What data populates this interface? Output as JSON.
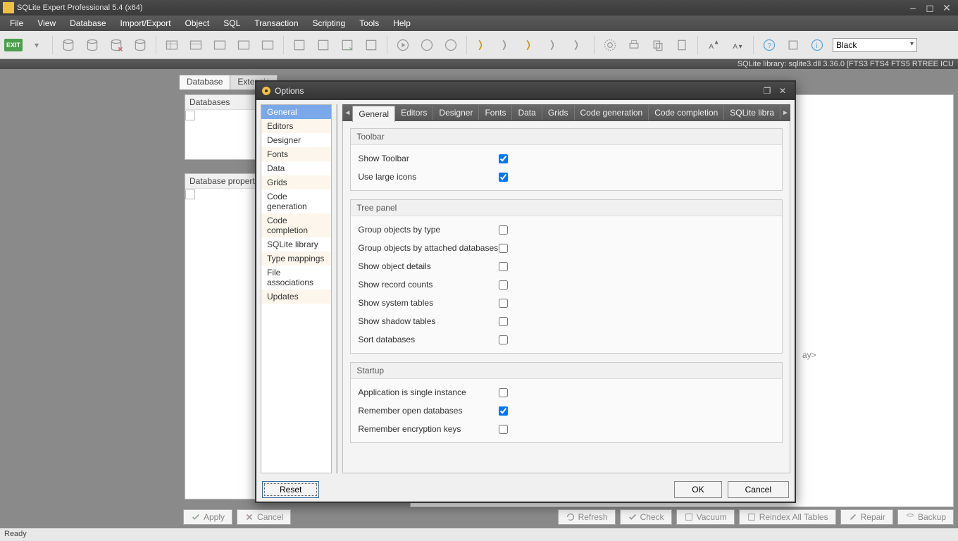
{
  "title": "SQLite Expert Professional 5.4 (x64)",
  "menu": [
    "File",
    "View",
    "Database",
    "Import/Export",
    "Object",
    "SQL",
    "Transaction",
    "Scripting",
    "Tools",
    "Help"
  ],
  "toolbar": {
    "exit": "EXIT",
    "theme_combo": "Black"
  },
  "libstrip": "SQLite library: sqlite3.dll 3.36.0 [FTS3 FTS4 FTS5 RTREE ICU",
  "left_tabs": [
    "Database",
    "Extensio"
  ],
  "panel_databases": "Databases",
  "panel_dbprops": "Database propert",
  "right_placeholder": "ay>",
  "bottom_buttons": {
    "apply": "Apply",
    "cancel": "Cancel",
    "refresh": "Refresh",
    "check": "Check",
    "vacuum": "Vacuum",
    "reindex": "Reindex All Tables",
    "repair": "Repair",
    "backup": "Backup"
  },
  "status": "Ready",
  "dialog": {
    "title": "Options",
    "categories": [
      "General",
      "Editors",
      "Designer",
      "Fonts",
      "Data",
      "Grids",
      "Code generation",
      "Code completion",
      "SQLite library",
      "Type mappings",
      "File associations",
      "Updates"
    ],
    "selected_category": 0,
    "tabs": [
      "General",
      "Editors",
      "Designer",
      "Fonts",
      "Data",
      "Grids",
      "Code generation",
      "Code completion",
      "SQLite libra"
    ],
    "selected_tab": 0,
    "groups": [
      {
        "title": "Toolbar",
        "rows": [
          {
            "label": "Show Toolbar",
            "checked": true
          },
          {
            "label": "Use large icons",
            "checked": true
          }
        ]
      },
      {
        "title": "Tree panel",
        "rows": [
          {
            "label": "Group objects by type",
            "checked": false
          },
          {
            "label": "Group objects by attached databases",
            "checked": false
          },
          {
            "label": "Show object details",
            "checked": false
          },
          {
            "label": "Show record counts",
            "checked": false
          },
          {
            "label": "Show system tables",
            "checked": false
          },
          {
            "label": "Show shadow tables",
            "checked": false
          },
          {
            "label": "Sort databases",
            "checked": false
          }
        ]
      },
      {
        "title": "Startup",
        "rows": [
          {
            "label": "Application is single instance",
            "checked": false
          },
          {
            "label": "Remember open databases",
            "checked": true
          },
          {
            "label": "Remember encryption keys",
            "checked": false
          }
        ]
      }
    ],
    "buttons": {
      "reset": "Reset",
      "ok": "OK",
      "cancel": "Cancel"
    }
  }
}
